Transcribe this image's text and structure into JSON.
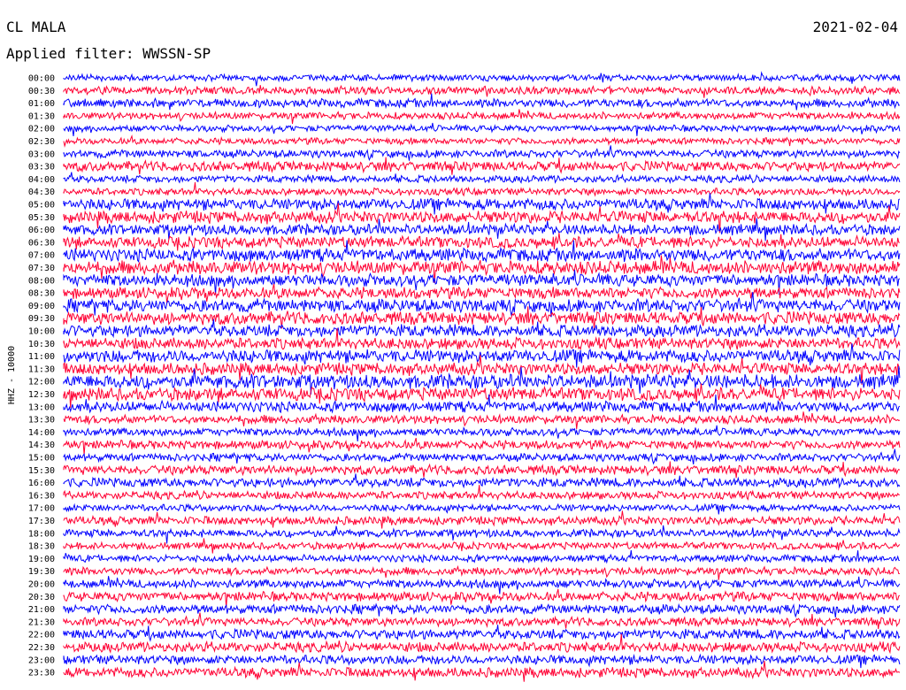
{
  "header": {
    "station": "CL MALA",
    "filter": "Applied filter: WWSSN-SP",
    "date": "2021-02-04"
  },
  "chart_data": {
    "type": "line",
    "subtype": "helicorder",
    "ylabel": "HHZ - 10000",
    "row_labels": [
      "00:00",
      "00:30",
      "01:00",
      "01:30",
      "02:00",
      "02:30",
      "03:00",
      "03:30",
      "04:00",
      "04:30",
      "05:00",
      "05:30",
      "06:00",
      "06:30",
      "07:00",
      "07:30",
      "08:00",
      "08:30",
      "09:00",
      "09:30",
      "10:00",
      "10:30",
      "11:00",
      "11:30",
      "12:00",
      "12:30",
      "13:00",
      "13:30",
      "14:00",
      "14:30",
      "15:00",
      "15:30",
      "16:00",
      "16:30",
      "17:00",
      "17:30",
      "18:00",
      "18:30",
      "19:00",
      "19:30",
      "20:00",
      "20:30",
      "21:00",
      "21:30",
      "22:00",
      "22:30",
      "23:00",
      "23:30"
    ],
    "series_colors": [
      "#0000ff",
      "#ff0033"
    ],
    "color_order": "alternating",
    "amplitude_by_row": [
      0.45,
      0.55,
      0.6,
      0.5,
      0.45,
      0.45,
      0.55,
      0.7,
      0.5,
      0.5,
      0.8,
      0.85,
      0.75,
      0.8,
      0.9,
      0.95,
      0.85,
      0.8,
      0.9,
      0.9,
      0.85,
      0.8,
      0.9,
      0.85,
      1.0,
      0.9,
      0.75,
      0.6,
      0.55,
      0.6,
      0.55,
      0.65,
      0.65,
      0.55,
      0.5,
      0.6,
      0.55,
      0.5,
      0.5,
      0.55,
      0.6,
      0.65,
      0.65,
      0.6,
      0.7,
      0.7,
      0.65,
      0.7
    ]
  }
}
